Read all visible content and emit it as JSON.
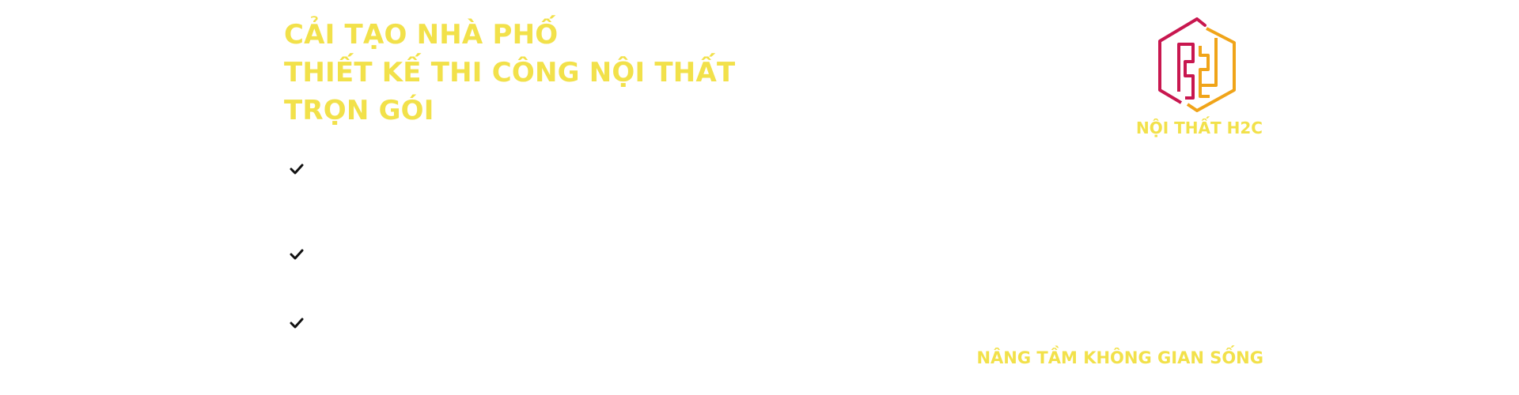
{
  "headline": {
    "line1": "CẢI TẠO NHÀ PHỐ",
    "line2": "THIẾT KẾ THI CÔNG NỘI THẤT",
    "line3": "TRỌN GÓI"
  },
  "checklist": {
    "items": [
      {
        "icon": "check-icon",
        "label": ""
      },
      {
        "icon": "check-icon",
        "label": ""
      },
      {
        "icon": "check-icon",
        "label": ""
      }
    ]
  },
  "brand": {
    "logo_icon": "h2c-hexagon-logo",
    "name": "NỘI THẤT H2C",
    "tagline": "NÂNG TẦM KHÔNG GIAN SỐNG"
  },
  "colors": {
    "accent_yellow": "#f2e14a",
    "logo_crimson": "#c8174f",
    "logo_orange": "#f0a419",
    "check_color": "#111111"
  }
}
